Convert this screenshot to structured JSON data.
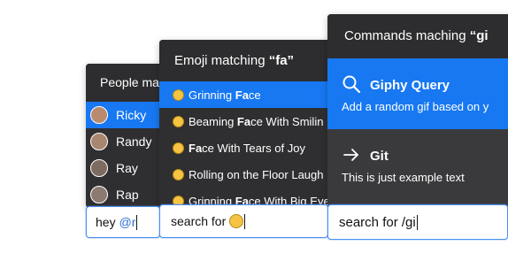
{
  "people_panel": {
    "header": "People matching",
    "items": [
      {
        "name": "Ricky",
        "avatar_color": "#b98a6e",
        "selected": true
      },
      {
        "name": "Randy",
        "avatar_color": "#a9866f",
        "selected": false
      },
      {
        "name": "Ray",
        "avatar_color": "#7d6b62",
        "selected": false
      },
      {
        "name": "Rap",
        "avatar_color": "#8c7a70",
        "selected": false
      }
    ]
  },
  "emoji_panel": {
    "header_prefix": "Emoji matching ",
    "header_query": "“fa”",
    "items": [
      {
        "pre": "Grinning ",
        "match": "Fa",
        "post": "ce",
        "icon": "grinning-face-emoji",
        "selected": true
      },
      {
        "pre": "Beaming ",
        "match": "Fa",
        "post": "ce With Smilin",
        "icon": "beaming-face-emoji",
        "selected": false
      },
      {
        "pre": "",
        "match": "Fa",
        "post": "ce With Tears of Joy",
        "icon": "tears-of-joy-emoji",
        "selected": false
      },
      {
        "pre": "Rolling on the Floor Laugh",
        "match": "",
        "post": "",
        "icon": "rolling-laughing-emoji",
        "selected": false
      },
      {
        "pre": "Grinning ",
        "match": "Fa",
        "post": "ce With Big Eye",
        "icon": "grinning-big-eyes-emoji",
        "selected": false
      }
    ]
  },
  "commands_panel": {
    "header_prefix": "Commands maching ",
    "header_query": "“gi",
    "items": [
      {
        "title": "Giphy Query",
        "description": "Add a random gif based on y",
        "icon": "search-icon",
        "selected": true
      },
      {
        "title": "Git",
        "description": "This is just example text",
        "icon": "arrow-right-icon",
        "selected": false
      }
    ]
  },
  "inputs": {
    "people": {
      "text": "hey",
      "mention": "@r"
    },
    "emoji": {
      "text": "search for"
    },
    "commands": {
      "text": "search for /gi"
    }
  },
  "colors": {
    "accent": "#1778f2",
    "panel_bg": "#2f2f31",
    "input_border": "#4a8ff0"
  }
}
